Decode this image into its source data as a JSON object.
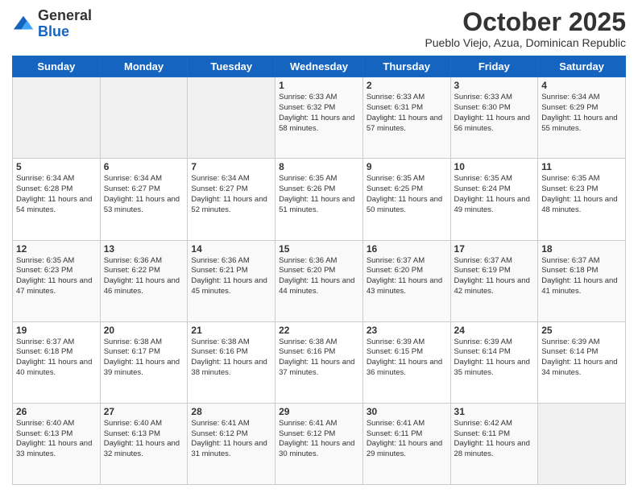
{
  "header": {
    "logo_general": "General",
    "logo_blue": "Blue",
    "month_title": "October 2025",
    "subtitle": "Pueblo Viejo, Azua, Dominican Republic"
  },
  "days_of_week": [
    "Sunday",
    "Monday",
    "Tuesday",
    "Wednesday",
    "Thursday",
    "Friday",
    "Saturday"
  ],
  "weeks": [
    [
      {
        "day": "",
        "sunrise": "",
        "sunset": "",
        "daylight": ""
      },
      {
        "day": "",
        "sunrise": "",
        "sunset": "",
        "daylight": ""
      },
      {
        "day": "",
        "sunrise": "",
        "sunset": "",
        "daylight": ""
      },
      {
        "day": "1",
        "sunrise": "Sunrise: 6:33 AM",
        "sunset": "Sunset: 6:32 PM",
        "daylight": "Daylight: 11 hours and 58 minutes."
      },
      {
        "day": "2",
        "sunrise": "Sunrise: 6:33 AM",
        "sunset": "Sunset: 6:31 PM",
        "daylight": "Daylight: 11 hours and 57 minutes."
      },
      {
        "day": "3",
        "sunrise": "Sunrise: 6:33 AM",
        "sunset": "Sunset: 6:30 PM",
        "daylight": "Daylight: 11 hours and 56 minutes."
      },
      {
        "day": "4",
        "sunrise": "Sunrise: 6:34 AM",
        "sunset": "Sunset: 6:29 PM",
        "daylight": "Daylight: 11 hours and 55 minutes."
      }
    ],
    [
      {
        "day": "5",
        "sunrise": "Sunrise: 6:34 AM",
        "sunset": "Sunset: 6:28 PM",
        "daylight": "Daylight: 11 hours and 54 minutes."
      },
      {
        "day": "6",
        "sunrise": "Sunrise: 6:34 AM",
        "sunset": "Sunset: 6:27 PM",
        "daylight": "Daylight: 11 hours and 53 minutes."
      },
      {
        "day": "7",
        "sunrise": "Sunrise: 6:34 AM",
        "sunset": "Sunset: 6:27 PM",
        "daylight": "Daylight: 11 hours and 52 minutes."
      },
      {
        "day": "8",
        "sunrise": "Sunrise: 6:35 AM",
        "sunset": "Sunset: 6:26 PM",
        "daylight": "Daylight: 11 hours and 51 minutes."
      },
      {
        "day": "9",
        "sunrise": "Sunrise: 6:35 AM",
        "sunset": "Sunset: 6:25 PM",
        "daylight": "Daylight: 11 hours and 50 minutes."
      },
      {
        "day": "10",
        "sunrise": "Sunrise: 6:35 AM",
        "sunset": "Sunset: 6:24 PM",
        "daylight": "Daylight: 11 hours and 49 minutes."
      },
      {
        "day": "11",
        "sunrise": "Sunrise: 6:35 AM",
        "sunset": "Sunset: 6:23 PM",
        "daylight": "Daylight: 11 hours and 48 minutes."
      }
    ],
    [
      {
        "day": "12",
        "sunrise": "Sunrise: 6:35 AM",
        "sunset": "Sunset: 6:23 PM",
        "daylight": "Daylight: 11 hours and 47 minutes."
      },
      {
        "day": "13",
        "sunrise": "Sunrise: 6:36 AM",
        "sunset": "Sunset: 6:22 PM",
        "daylight": "Daylight: 11 hours and 46 minutes."
      },
      {
        "day": "14",
        "sunrise": "Sunrise: 6:36 AM",
        "sunset": "Sunset: 6:21 PM",
        "daylight": "Daylight: 11 hours and 45 minutes."
      },
      {
        "day": "15",
        "sunrise": "Sunrise: 6:36 AM",
        "sunset": "Sunset: 6:20 PM",
        "daylight": "Daylight: 11 hours and 44 minutes."
      },
      {
        "day": "16",
        "sunrise": "Sunrise: 6:37 AM",
        "sunset": "Sunset: 6:20 PM",
        "daylight": "Daylight: 11 hours and 43 minutes."
      },
      {
        "day": "17",
        "sunrise": "Sunrise: 6:37 AM",
        "sunset": "Sunset: 6:19 PM",
        "daylight": "Daylight: 11 hours and 42 minutes."
      },
      {
        "day": "18",
        "sunrise": "Sunrise: 6:37 AM",
        "sunset": "Sunset: 6:18 PM",
        "daylight": "Daylight: 11 hours and 41 minutes."
      }
    ],
    [
      {
        "day": "19",
        "sunrise": "Sunrise: 6:37 AM",
        "sunset": "Sunset: 6:18 PM",
        "daylight": "Daylight: 11 hours and 40 minutes."
      },
      {
        "day": "20",
        "sunrise": "Sunrise: 6:38 AM",
        "sunset": "Sunset: 6:17 PM",
        "daylight": "Daylight: 11 hours and 39 minutes."
      },
      {
        "day": "21",
        "sunrise": "Sunrise: 6:38 AM",
        "sunset": "Sunset: 6:16 PM",
        "daylight": "Daylight: 11 hours and 38 minutes."
      },
      {
        "day": "22",
        "sunrise": "Sunrise: 6:38 AM",
        "sunset": "Sunset: 6:16 PM",
        "daylight": "Daylight: 11 hours and 37 minutes."
      },
      {
        "day": "23",
        "sunrise": "Sunrise: 6:39 AM",
        "sunset": "Sunset: 6:15 PM",
        "daylight": "Daylight: 11 hours and 36 minutes."
      },
      {
        "day": "24",
        "sunrise": "Sunrise: 6:39 AM",
        "sunset": "Sunset: 6:14 PM",
        "daylight": "Daylight: 11 hours and 35 minutes."
      },
      {
        "day": "25",
        "sunrise": "Sunrise: 6:39 AM",
        "sunset": "Sunset: 6:14 PM",
        "daylight": "Daylight: 11 hours and 34 minutes."
      }
    ],
    [
      {
        "day": "26",
        "sunrise": "Sunrise: 6:40 AM",
        "sunset": "Sunset: 6:13 PM",
        "daylight": "Daylight: 11 hours and 33 minutes."
      },
      {
        "day": "27",
        "sunrise": "Sunrise: 6:40 AM",
        "sunset": "Sunset: 6:13 PM",
        "daylight": "Daylight: 11 hours and 32 minutes."
      },
      {
        "day": "28",
        "sunrise": "Sunrise: 6:41 AM",
        "sunset": "Sunset: 6:12 PM",
        "daylight": "Daylight: 11 hours and 31 minutes."
      },
      {
        "day": "29",
        "sunrise": "Sunrise: 6:41 AM",
        "sunset": "Sunset: 6:12 PM",
        "daylight": "Daylight: 11 hours and 30 minutes."
      },
      {
        "day": "30",
        "sunrise": "Sunrise: 6:41 AM",
        "sunset": "Sunset: 6:11 PM",
        "daylight": "Daylight: 11 hours and 29 minutes."
      },
      {
        "day": "31",
        "sunrise": "Sunrise: 6:42 AM",
        "sunset": "Sunset: 6:11 PM",
        "daylight": "Daylight: 11 hours and 28 minutes."
      },
      {
        "day": "",
        "sunrise": "",
        "sunset": "",
        "daylight": ""
      }
    ]
  ]
}
